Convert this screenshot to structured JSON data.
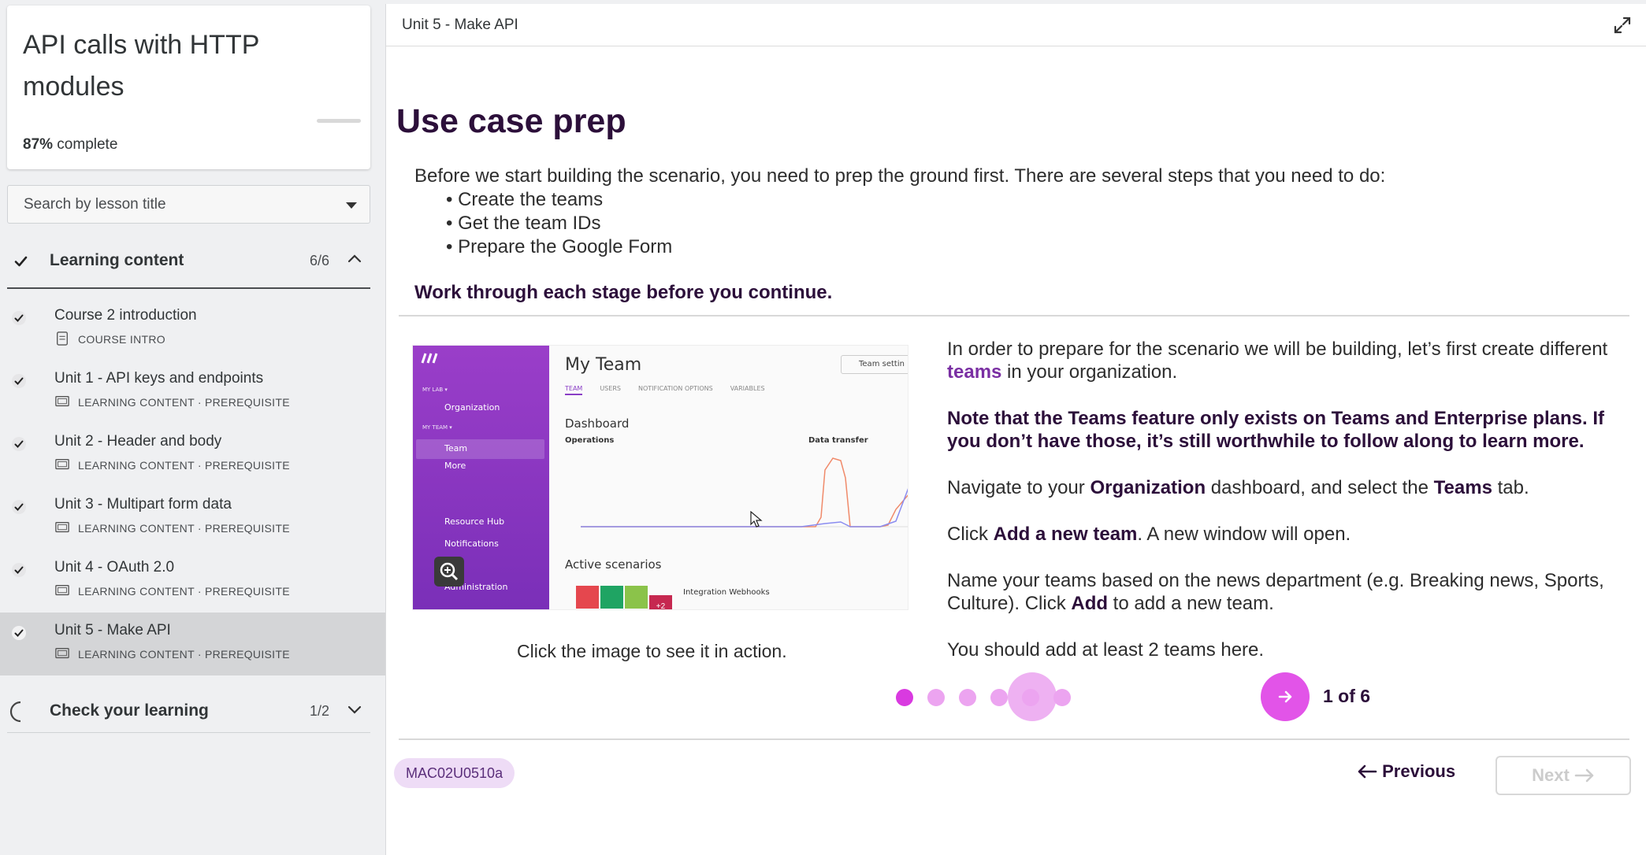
{
  "sidebar": {
    "course_title": "API calls with HTTP modules",
    "progress_percent": "87%",
    "progress_suffix": " complete",
    "search_placeholder": "Search by lesson title",
    "sections": [
      {
        "label": "Learning content",
        "count": "6/6"
      },
      {
        "label": "Check your learning",
        "count": "1/2"
      }
    ],
    "lessons": [
      {
        "title": "Course 2 introduction",
        "meta": "COURSE INTRO"
      },
      {
        "title": "Unit 1 - API keys and endpoints",
        "meta": "LEARNING CONTENT · PREREQUISITE"
      },
      {
        "title": "Unit 2 - Header and body",
        "meta": "LEARNING CONTENT · PREREQUISITE"
      },
      {
        "title": "Unit 3 - Multipart form data",
        "meta": "LEARNING CONTENT · PREREQUISITE"
      },
      {
        "title": "Unit 4 - OAuth 2.0",
        "meta": "LEARNING CONTENT · PREREQUISITE"
      },
      {
        "title": "Unit 5 - Make API",
        "meta": "LEARNING CONTENT · PREREQUISITE"
      }
    ]
  },
  "main": {
    "unit_label": "Unit 5 - Make API",
    "heading": "Use case prep",
    "intro": "Before we start building the scenario, you need to prep the ground first. There are several steps that you need to do:",
    "steps": [
      "Create the teams",
      "Get the team IDs",
      "Prepare the Google Form"
    ],
    "stage_note": "Work through each stage before you continue.",
    "caption": "Click the image to see it in action.",
    "slide": {
      "p1_a": "In order to prepare for the scenario we will be building, let’s first create different ",
      "p1_link": "teams",
      "p1_b": " in your organization.",
      "note": "Note that the Teams feature only exists on Teams and Enterprise plans. If you don’t have those, it’s still worthwhile to follow along to learn more.",
      "p3_a": "Navigate to your ",
      "p3_b1": "Organization",
      "p3_c": " dashboard, and select the ",
      "p3_b2": "Teams",
      "p3_d": " tab.",
      "p4_a": "Click ",
      "p4_b": "Add a new team",
      "p4_c": ". A new window will open.",
      "p5_a": "Name your teams based on the news department (e.g. Breaking news, Sports, Culture). Click ",
      "p5_b": "Add",
      "p5_c": " to add a new team.",
      "p6": "You should add at least 2 teams here."
    },
    "pager": "1 of 6",
    "current_slide": 1,
    "total_slides": 6,
    "code": "MAC02U0510a",
    "prev_label": "Previous",
    "next_label": "Next"
  },
  "screenshot": {
    "side_items": [
      "MY LAB ▾",
      "Organization",
      "MY TEAM ▾",
      "Team",
      "More",
      "Resource Hub",
      "Notifications",
      "Administration"
    ],
    "title": "My Team",
    "tabs": [
      "TEAM",
      "USERS",
      "NOTIFICATION OPTIONS",
      "VARIABLES"
    ],
    "button": "Team settin",
    "dashboard": "Dashboard",
    "operations": "Operations",
    "data_transfer": "Data transfer",
    "active": "Active scenarios",
    "scenario": "Integration Webhooks",
    "plus": "+2"
  },
  "colors": {
    "accent": "#e254e8",
    "accent_light": "#eeb1f2",
    "heading": "#2c0f3a",
    "link": "#7a2fa3"
  }
}
